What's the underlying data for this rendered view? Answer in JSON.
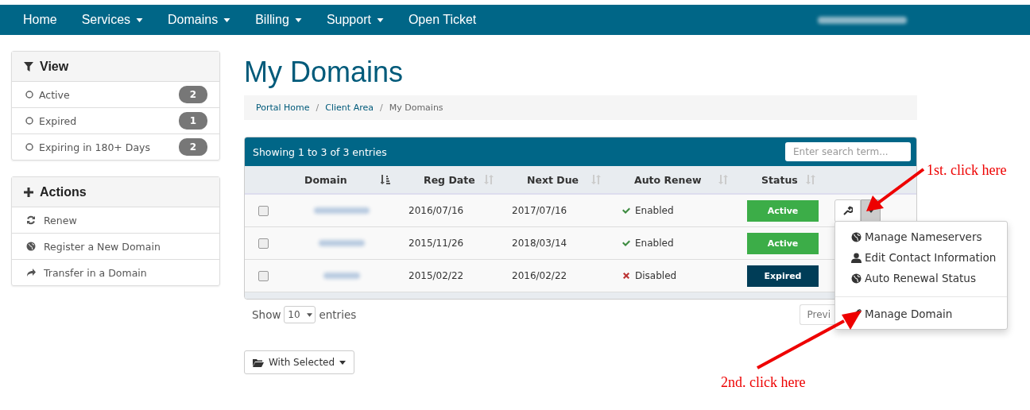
{
  "nav": {
    "items": [
      {
        "label": "Home",
        "has_menu": false
      },
      {
        "label": "Services",
        "has_menu": true
      },
      {
        "label": "Domains",
        "has_menu": true
      },
      {
        "label": "Billing",
        "has_menu": true
      },
      {
        "label": "Support",
        "has_menu": true
      },
      {
        "label": "Open Ticket",
        "has_menu": false
      }
    ]
  },
  "sidebar": {
    "view": {
      "title": "View",
      "items": [
        {
          "label": "Active",
          "count": "2",
          "selected": false
        },
        {
          "label": "Expired",
          "count": "1",
          "selected": false
        },
        {
          "label": "Expiring in 180+ Days",
          "count": "2",
          "selected": false
        }
      ]
    },
    "actions": {
      "title": "Actions",
      "items": [
        {
          "label": "Renew",
          "kind": "renew"
        },
        {
          "label": "Register a New Domain",
          "kind": "register"
        },
        {
          "label": "Transfer in a Domain",
          "kind": "transfer"
        }
      ]
    }
  },
  "page_title": "My Domains",
  "breadcrumb": [
    "Portal Home",
    "Client Area",
    "My Domains"
  ],
  "breadcrumb_separator": "/",
  "table": {
    "info": "Showing 1 to 3 of 3 entries",
    "search": {
      "placeholder": "Enter search term..."
    },
    "columns": [
      {
        "label": "Domain",
        "sorted": true
      },
      {
        "label": "Reg Date",
        "sorted": false
      },
      {
        "label": "Next Due",
        "sorted": false
      },
      {
        "label": "Auto Renew",
        "sorted": false
      },
      {
        "label": "Status",
        "sorted": false
      }
    ],
    "rows": [
      {
        "checked": false,
        "reg_date": "2016/07/16",
        "next_due": "2017/07/16",
        "auto_renew": "Enabled",
        "auto_renew_on": true,
        "status": "Active",
        "kind": "active",
        "has_actions": true
      },
      {
        "checked": false,
        "reg_date": "2015/11/26",
        "next_due": "2018/03/14",
        "auto_renew": "Enabled",
        "auto_renew_on": true,
        "status": "Active",
        "kind": "active",
        "has_actions": false
      },
      {
        "checked": false,
        "reg_date": "2015/02/22",
        "next_due": "2016/02/22",
        "auto_renew": "Disabled",
        "auto_renew_on": false,
        "status": "Expired",
        "kind": "expired",
        "has_actions": false
      }
    ]
  },
  "length": {
    "before": "Show",
    "value": "10",
    "after": "entries"
  },
  "pagination": {
    "previous": "Previ"
  },
  "with_selected": "With Selected",
  "menu": {
    "items": [
      {
        "label": "Manage Nameservers",
        "kind": "globe",
        "divider_before": false
      },
      {
        "label": "Edit Contact Information",
        "kind": "user",
        "divider_before": false
      },
      {
        "label": "Auto Renewal Status",
        "kind": "globe",
        "divider_before": false
      },
      {
        "label": "Manage Domain",
        "kind": "pencil",
        "divider_before": true
      }
    ]
  },
  "annotations": [
    {
      "text": "1st. click here"
    },
    {
      "text": "2nd. click here"
    }
  ]
}
